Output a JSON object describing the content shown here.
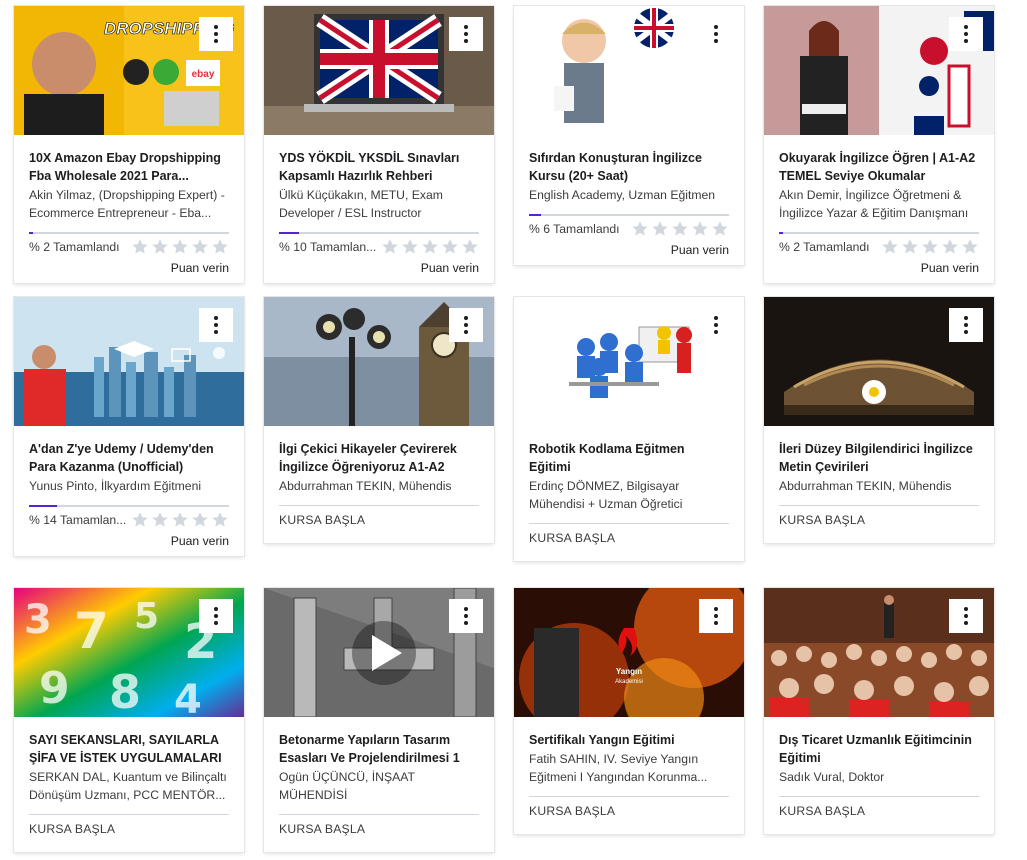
{
  "courses": [
    {
      "title": "10X Amazon Ebay Dropshipping Fba Wholesale 2021 Para...",
      "author": "Akin Yilmaz, (Dropshipping Expert) - Ecommerce Entrepreneur - Eba...",
      "progress_text": "% 2 Tamamlandı",
      "progress": 2,
      "rate_label": "Puan verin",
      "thumb_text": "DROPSHIPPING",
      "thumb_sub": "ebay"
    },
    {
      "title": "YDS YÖKDİL YKSDİL Sınavları Kapsamlı Hazırlık Rehberi",
      "author": "Ülkü Küçükakın, METU, Exam Developer / ESL Instructor",
      "progress_text": "% 10 Tamamlan...",
      "progress": 10,
      "rate_label": "Puan verin"
    },
    {
      "title": "Sıfırdan Konuşturan İngilizce Kursu (20+ Saat)",
      "author": "English Academy, Uzman Eğitmen",
      "progress_text": "% 6 Tamamlandı",
      "progress": 6,
      "rate_label": "Puan verin"
    },
    {
      "title": "Okuyarak İngilizce Öğren | A1-A2 TEMEL Seviye Okumalar",
      "author": "Akın Demir, İngilizce Öğretmeni & İngilizce Yazar & Eğitim Danışmanı",
      "progress_text": "% 2 Tamamlandı",
      "progress": 2,
      "rate_label": "Puan verin"
    },
    {
      "title": "A'dan Z'ye Udemy / Udemy'den Para Kazanma (Unofficial)",
      "author": "Yunus Pinto, İlkyardım Eğitmeni",
      "progress_text": "% 14 Tamamlan...",
      "progress": 14,
      "rate_label": "Puan verin"
    },
    {
      "title": "İlgi Çekici Hikayeler Çevirerek İngilizce Öğreniyoruz A1-A2",
      "author": "Abdurrahman TEKIN, Mühendis",
      "start_label": "KURSA BAŞLA"
    },
    {
      "title": "Robotik Kodlama Eğitmen Eğitimi",
      "author": "Erdinç DÖNMEZ, Bilgisayar Mühendisi + Uzman Öğretici",
      "start_label": "KURSA BAŞLA"
    },
    {
      "title": "İleri Düzey Bilgilendirici İngilizce Metin Çevirileri",
      "author": "Abdurrahman TEKIN, Mühendis",
      "start_label": "KURSA BAŞLA"
    },
    {
      "title": "SAYI SEKANSLARI, SAYILARLA ŞİFA VE İSTEK UYGULAMALARI",
      "author": "SERKAN DAL, Kuantum ve Bilinçaltı Dönüşüm Uzmanı, PCC MENTÖR...",
      "start_label": "KURSA BAŞLA"
    },
    {
      "title": "Betonarme Yapıların Tasarım Esasları Ve Projelendirilmesi 1",
      "author": "Ogün ÜÇÜNCÜ, İNŞAAT MÜHENDİSİ",
      "start_label": "KURSA BAŞLA"
    },
    {
      "title": "Sertifikalı Yangın Eğitimi",
      "author": "Fatih SAHIN, IV. Seviye Yangın Eğitmeni I Yangından Korunma...",
      "start_label": "KURSA BAŞLA",
      "thumb_text": "Yangın",
      "thumb_sub": "Akademisi"
    },
    {
      "title": "Dış Ticaret Uzmanlık Eğitimcinin Eğitimi",
      "author": "Sadık Vural, Doktor",
      "start_label": "KURSA BAŞLA"
    }
  ],
  "colors": {
    "accent": "#5624d0",
    "star": "#d1d7dc",
    "divider": "#d1d7dc"
  },
  "icons": {
    "menu": "kebab-menu-icon",
    "star": "star-icon",
    "play": "play-icon"
  }
}
